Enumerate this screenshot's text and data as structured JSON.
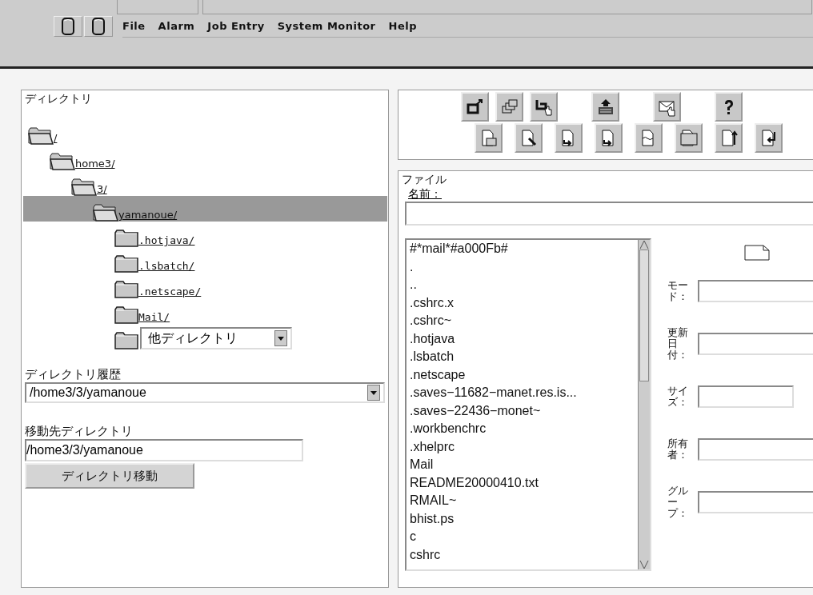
{
  "menu": [
    "File",
    "Alarm",
    "Job Entry",
    "System Monitor",
    "Help"
  ],
  "directory_panel": {
    "title": "ディレクトリ",
    "tree": [
      {
        "label": "/",
        "expanded": true,
        "selected": false,
        "children": [
          {
            "label": "home3/",
            "expanded": true,
            "selected": false,
            "children": [
              {
                "label": "3/",
                "expanded": true,
                "selected": false,
                "children": [
                  {
                    "label": "yamanoue/",
                    "expanded": true,
                    "selected": true,
                    "children": [
                      {
                        "kind": "link",
                        "label": ".hotjava/",
                        "expanded": false,
                        "selected": false
                      },
                      {
                        "kind": "link",
                        "label": ".lsbatch/",
                        "expanded": false,
                        "selected": false
                      },
                      {
                        "kind": "link",
                        "label": ".netscape/",
                        "expanded": false,
                        "selected": false
                      },
                      {
                        "kind": "link",
                        "label": "Mail/",
                        "expanded": false,
                        "selected": false
                      },
                      {
                        "kind": "select",
                        "label": "他ディレクトリ",
                        "expanded": false,
                        "selected": false
                      }
                    ]
                  }
                ]
              }
            ]
          }
        ]
      }
    ],
    "history_label": "ディレクトリ履歴",
    "history_value": "/home3/3/yamanoue",
    "target_label": "移動先ディレクトリ",
    "target_value": "/home3/3/yamanoue",
    "move_button": "ディレクトリ移動"
  },
  "file_panel": {
    "title": "ファイル",
    "name_label": "名前：",
    "files": [
      "#*mail*#a000Fb#",
      ".",
      "..",
      ".cshrc.x",
      ".cshrc~",
      ".hotjava",
      ".lsbatch",
      ".netscape",
      ".saves−11682−manet.res.is...",
      ".saves−22436−monet~",
      ".workbenchrc",
      ".xhelprc",
      "Mail",
      "README20000410.txt",
      "RMAIL~",
      "bhist.ps",
      "c",
      "cshrc"
    ],
    "details": [
      {
        "label": "モード：",
        "short": false
      },
      {
        "label": "更新日付：",
        "short": false
      },
      {
        "label": "サイズ：",
        "short": true
      },
      {
        "label": "所有者：",
        "short": false
      },
      {
        "label": "グループ：",
        "short": false
      }
    ]
  }
}
